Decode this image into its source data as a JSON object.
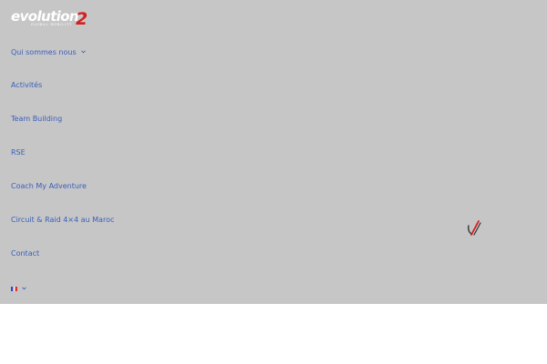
{
  "logo": {
    "word": "evolution",
    "number": "2",
    "tagline": "GLOBAL MOBILITY"
  },
  "menu": {
    "items": [
      {
        "label": "Qui sommes nous",
        "has_submenu": true
      },
      {
        "label": "Activités",
        "has_submenu": false
      },
      {
        "label": "Team Building",
        "has_submenu": false
      },
      {
        "label": "RSE",
        "has_submenu": false
      },
      {
        "label": "Coach My Adventure",
        "has_submenu": false
      },
      {
        "label": "Circuit & Raid 4×4 au Maroc",
        "has_submenu": false
      },
      {
        "label": "Contact",
        "has_submenu": false
      }
    ],
    "language": {
      "flag": "fr-flag-icon",
      "has_submenu": true
    }
  },
  "close_button": {
    "icon": "close-icon"
  },
  "colors": {
    "overlay": "#c6c6c6",
    "link": "#3a5fbd",
    "accent": "#d62020"
  }
}
